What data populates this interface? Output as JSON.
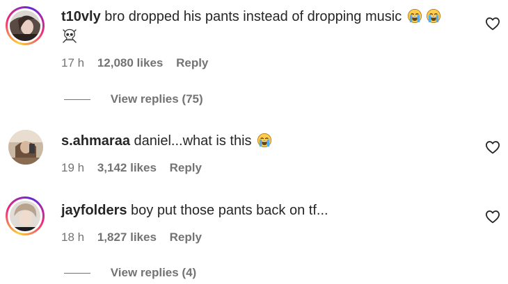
{
  "comments": [
    {
      "username": "t10vly",
      "text": "bro dropped his pants instead of dropping music",
      "emojis": [
        "loudly-crying-face",
        "loudly-crying-face"
      ],
      "second_line_emoji": "skull-and-crossbones",
      "time": "17 h",
      "likes": "12,080 likes",
      "reply": "Reply",
      "view_replies": "View replies (75)",
      "has_story_ring": true
    },
    {
      "username": "s.ahmaraa",
      "text": "daniel...what is this",
      "emojis": [
        "loudly-crying-face"
      ],
      "time": "19 h",
      "likes": "3,142 likes",
      "reply": "Reply",
      "has_story_ring": false
    },
    {
      "username": "jayfolders",
      "text": "boy put those pants back on tf...",
      "emojis": [],
      "time": "18 h",
      "likes": "1,827 likes",
      "reply": "Reply",
      "view_replies": "View replies (4)",
      "has_story_ring": true
    }
  ],
  "icons": {
    "like": "heart-outline-icon"
  },
  "colors": {
    "text_primary": "#262626",
    "text_secondary": "#737373"
  }
}
